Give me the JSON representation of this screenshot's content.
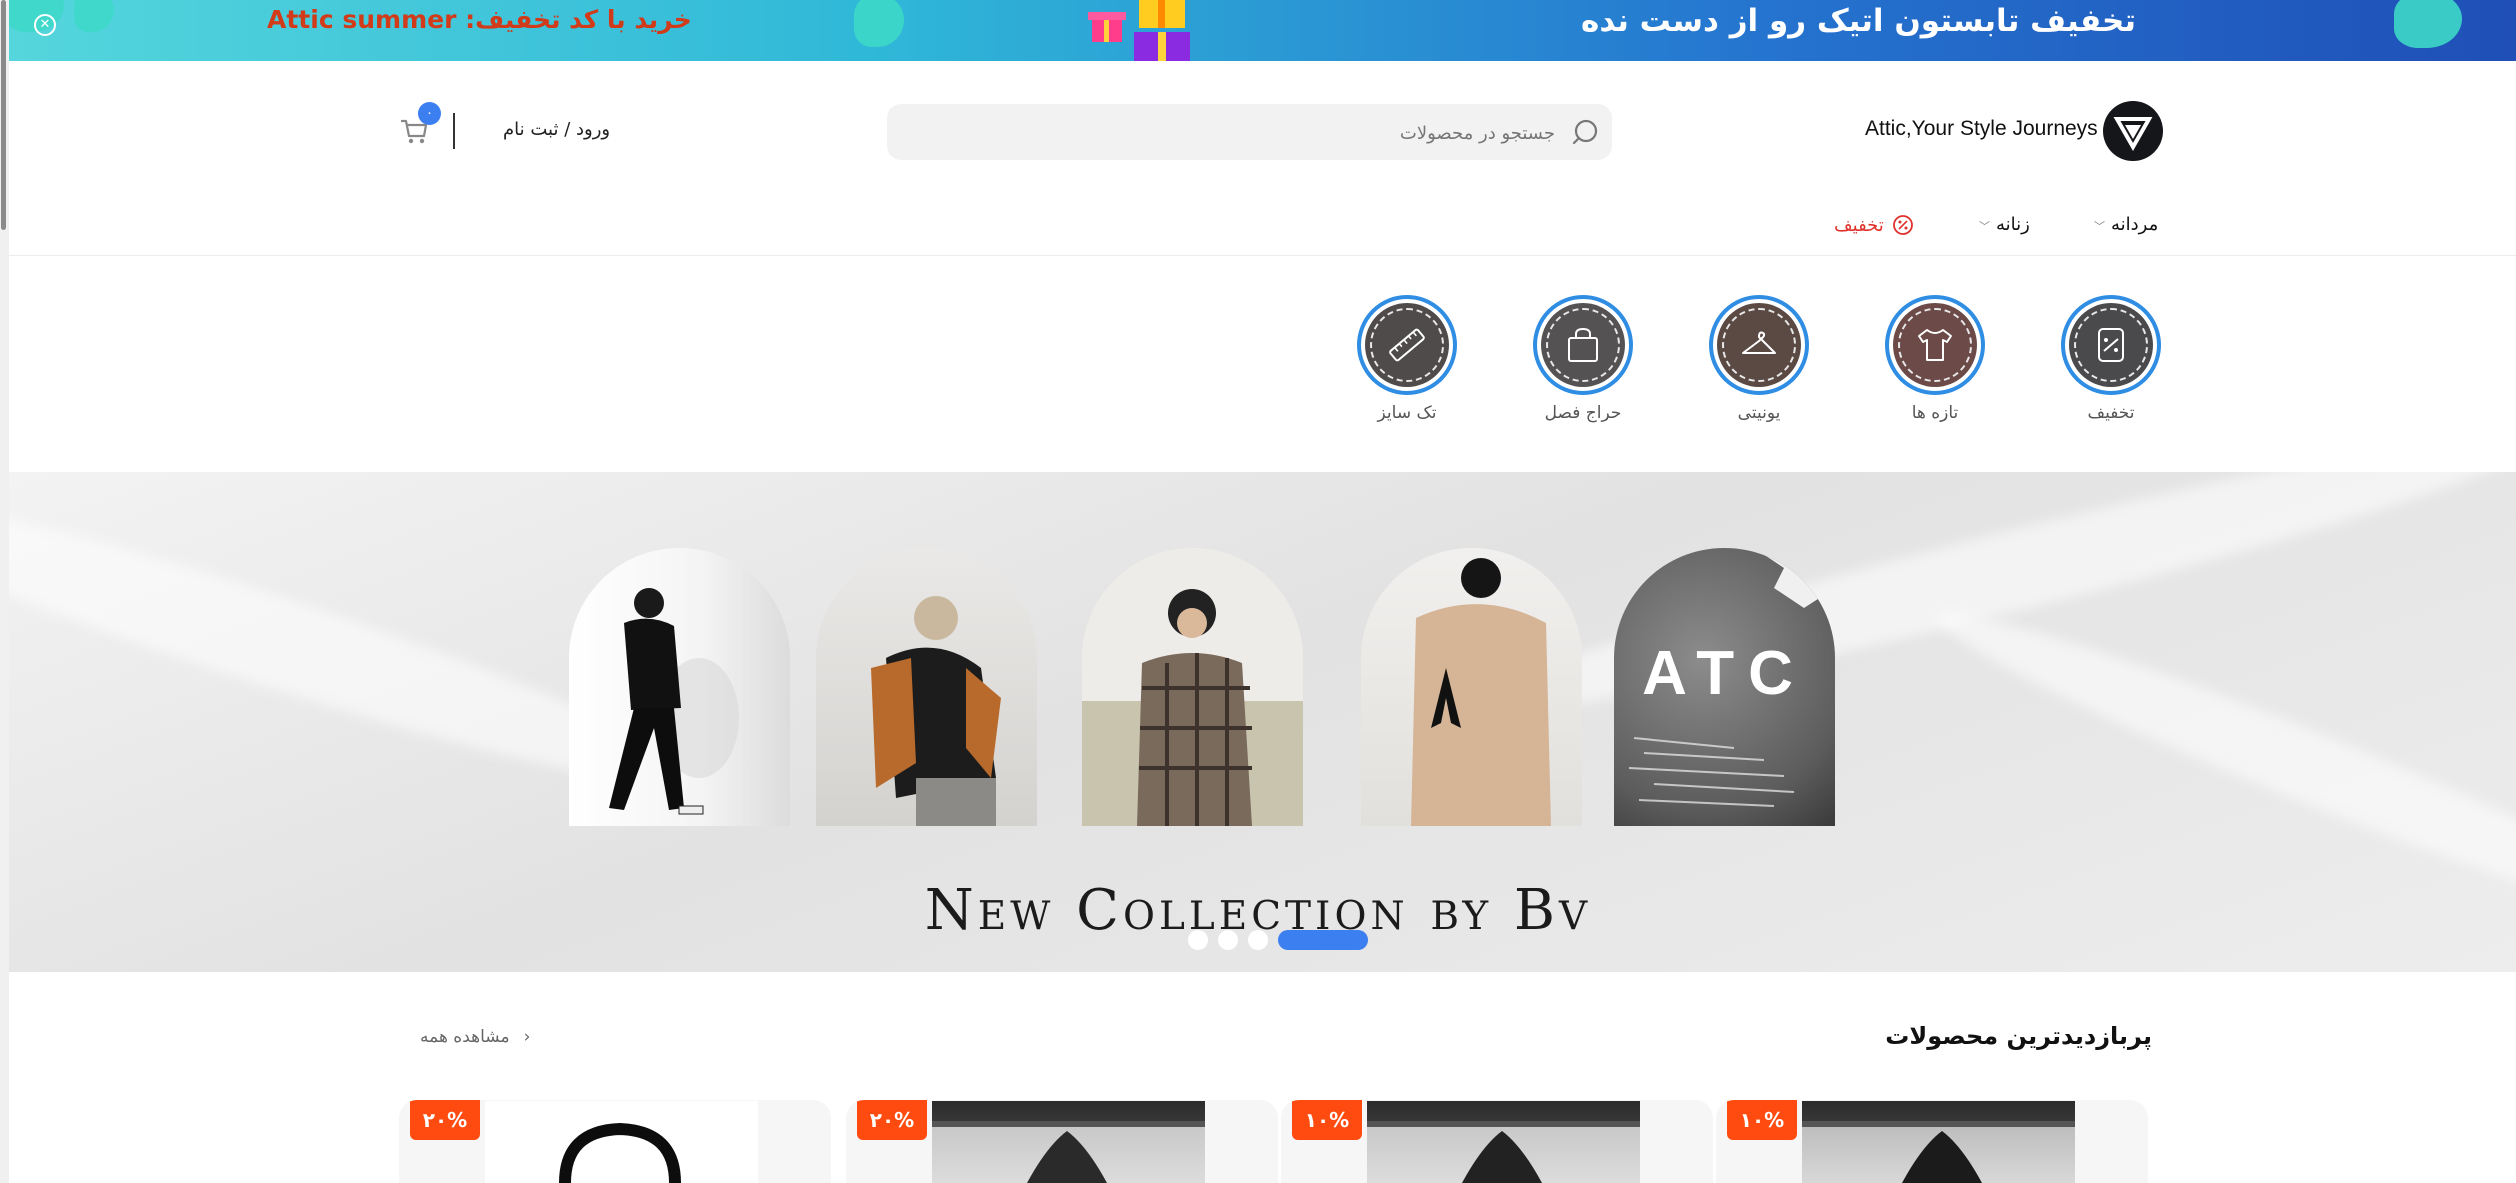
{
  "promo": {
    "code_text": "خرید با کد تخفیف: Attic summer",
    "headline": "تخفیف تابستون اتیک رو از دست نده",
    "close_icon": "close-circle-icon"
  },
  "header": {
    "brand_name": "Attic,Your Style Journeys",
    "search_placeholder": "جستجو در محصولات",
    "login_text": "ورود / ثبت نام",
    "cart_count": "۰"
  },
  "nav": {
    "men": "مردانه",
    "women": "زنانه",
    "sale": "تخفیف"
  },
  "stories": [
    {
      "label": "تخفیف",
      "icon": "discount-tag-icon"
    },
    {
      "label": "تازه ها",
      "icon": "tshirt-icon"
    },
    {
      "label": "یونیتی",
      "icon": "hanger-icon"
    },
    {
      "label": "حراج فصل",
      "icon": "shopping-bag-icon"
    },
    {
      "label": "تک سایز",
      "icon": "ruler-icon"
    }
  ],
  "hero": {
    "title": "New Collection by Bv",
    "arch_text": "ATC",
    "active_slide": 4,
    "slide_count": 4
  },
  "products": {
    "title": "پربازدیدترین محصولات",
    "view_all": "مشاهده همه",
    "badges": [
      "۱۰%",
      "۱۰%",
      "۲۰%",
      "۲۰%"
    ]
  },
  "colors": {
    "accent": "#3b7ff0",
    "sale_red": "#e0322d",
    "badge_orange": "#ff4b0f"
  }
}
